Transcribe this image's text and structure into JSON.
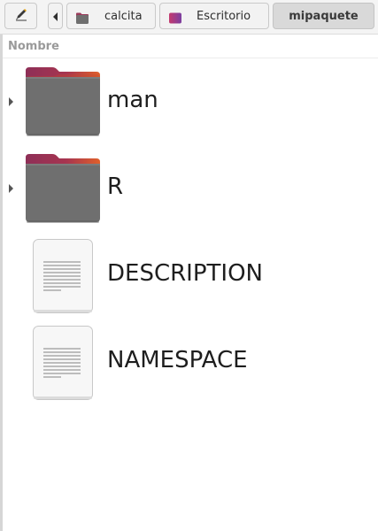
{
  "toolbar": {
    "edit_icon": "pencil-icon",
    "back_icon": "chevron-left-icon",
    "breadcrumbs": [
      {
        "label": "calcita",
        "icon": "folder-icon"
      },
      {
        "label": "Escritorio",
        "icon": "desktop-folder-icon"
      },
      {
        "label": "mipaquete",
        "icon": ""
      }
    ]
  },
  "list": {
    "column_header": "Nombre",
    "items": [
      {
        "name": "man",
        "type": "folder",
        "icon": "folder-icon"
      },
      {
        "name": "R",
        "type": "folder",
        "icon": "folder-icon"
      },
      {
        "name": "DESCRIPTION",
        "type": "file",
        "icon": "text-file-icon"
      },
      {
        "name": "NAMESPACE",
        "type": "file",
        "icon": "text-file-icon"
      }
    ]
  },
  "colors": {
    "folder_body": "#6f6f6f",
    "folder_tab_magenta": "#8e2f57",
    "folder_tab_orange": "#e0602b",
    "toolbar_bg": "#f4f4f4",
    "active_crumb_bg": "#d9d9d9"
  }
}
